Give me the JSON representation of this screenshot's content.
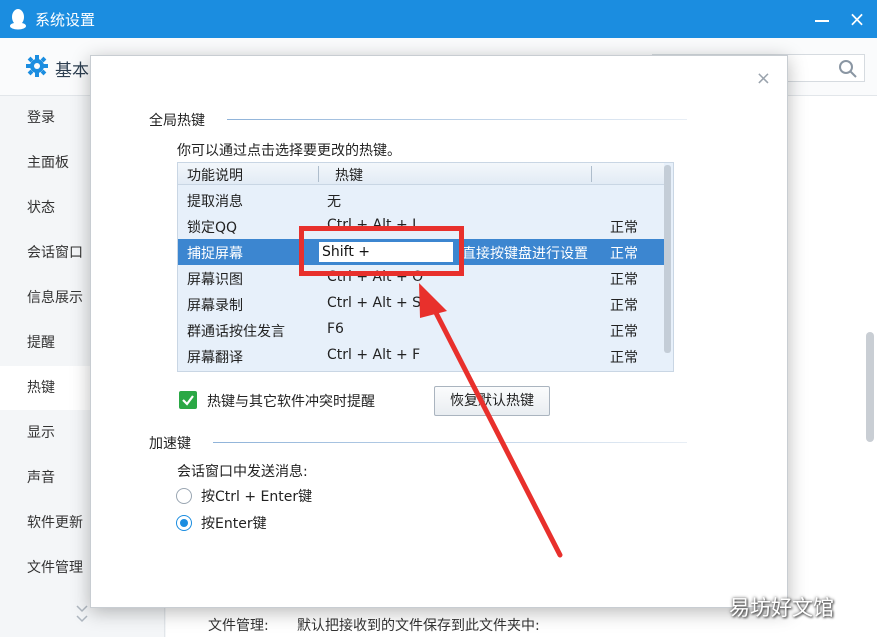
{
  "window": {
    "title": "系统设置"
  },
  "header": {
    "section_label": "基本",
    "search_placeholder": ""
  },
  "sidebar": {
    "items": [
      {
        "label": "登录",
        "active": false
      },
      {
        "label": "主面板",
        "active": false
      },
      {
        "label": "状态",
        "active": false
      },
      {
        "label": "会话窗口",
        "active": false
      },
      {
        "label": "信息展示",
        "active": false
      },
      {
        "label": "提醒",
        "active": false
      },
      {
        "label": "热键",
        "active": true
      },
      {
        "label": "显示",
        "active": false
      },
      {
        "label": "声音",
        "active": false
      },
      {
        "label": "软件更新",
        "active": false
      },
      {
        "label": "文件管理",
        "active": false
      }
    ]
  },
  "background": {
    "file_label": "文件管理:",
    "file_desc": "默认把接收到的文件保存到此文件夹中:"
  },
  "dialog": {
    "close_glyph": "×",
    "global_hotkeys": {
      "title": "全局热键",
      "hint": "你可以通过点击选择要更改的热键。",
      "columns": [
        "功能说明",
        "热键",
        ""
      ],
      "rows": [
        {
          "func": "提取消息",
          "key": "无",
          "status": ""
        },
        {
          "func": "锁定QQ",
          "key": "Ctrl + Alt + L",
          "status": "正常"
        },
        {
          "func": "捕捉屏幕",
          "key": "Shift +",
          "hint": "直接按键盘进行设置",
          "status": "正常",
          "selected": true
        },
        {
          "func": "屏幕识图",
          "key": "Ctrl + Alt + O",
          "status": "正常"
        },
        {
          "func": "屏幕录制",
          "key": "Ctrl + Alt + S",
          "status": "正常"
        },
        {
          "func": "群通话按住发言",
          "key": "F6",
          "status": "正常"
        },
        {
          "func": "屏幕翻译",
          "key": "Ctrl + Alt + F",
          "status": "正常"
        }
      ],
      "conflict_checkbox": {
        "label": "热键与其它软件冲突时提醒",
        "checked": true
      },
      "reset_button": "恢复默认热键"
    },
    "accelerator": {
      "title": "加速键",
      "send_label": "会话窗口中发送消息:",
      "options": [
        {
          "label": "按Ctrl + Enter键",
          "selected": false
        },
        {
          "label": "按Enter键",
          "selected": true
        }
      ]
    }
  },
  "watermark": "易坊好文馆",
  "colors": {
    "titlebar": "#1b8de0",
    "selected_row": "#3c86d0",
    "annotation": "#e8302c",
    "checkbox": "#2aa845"
  }
}
